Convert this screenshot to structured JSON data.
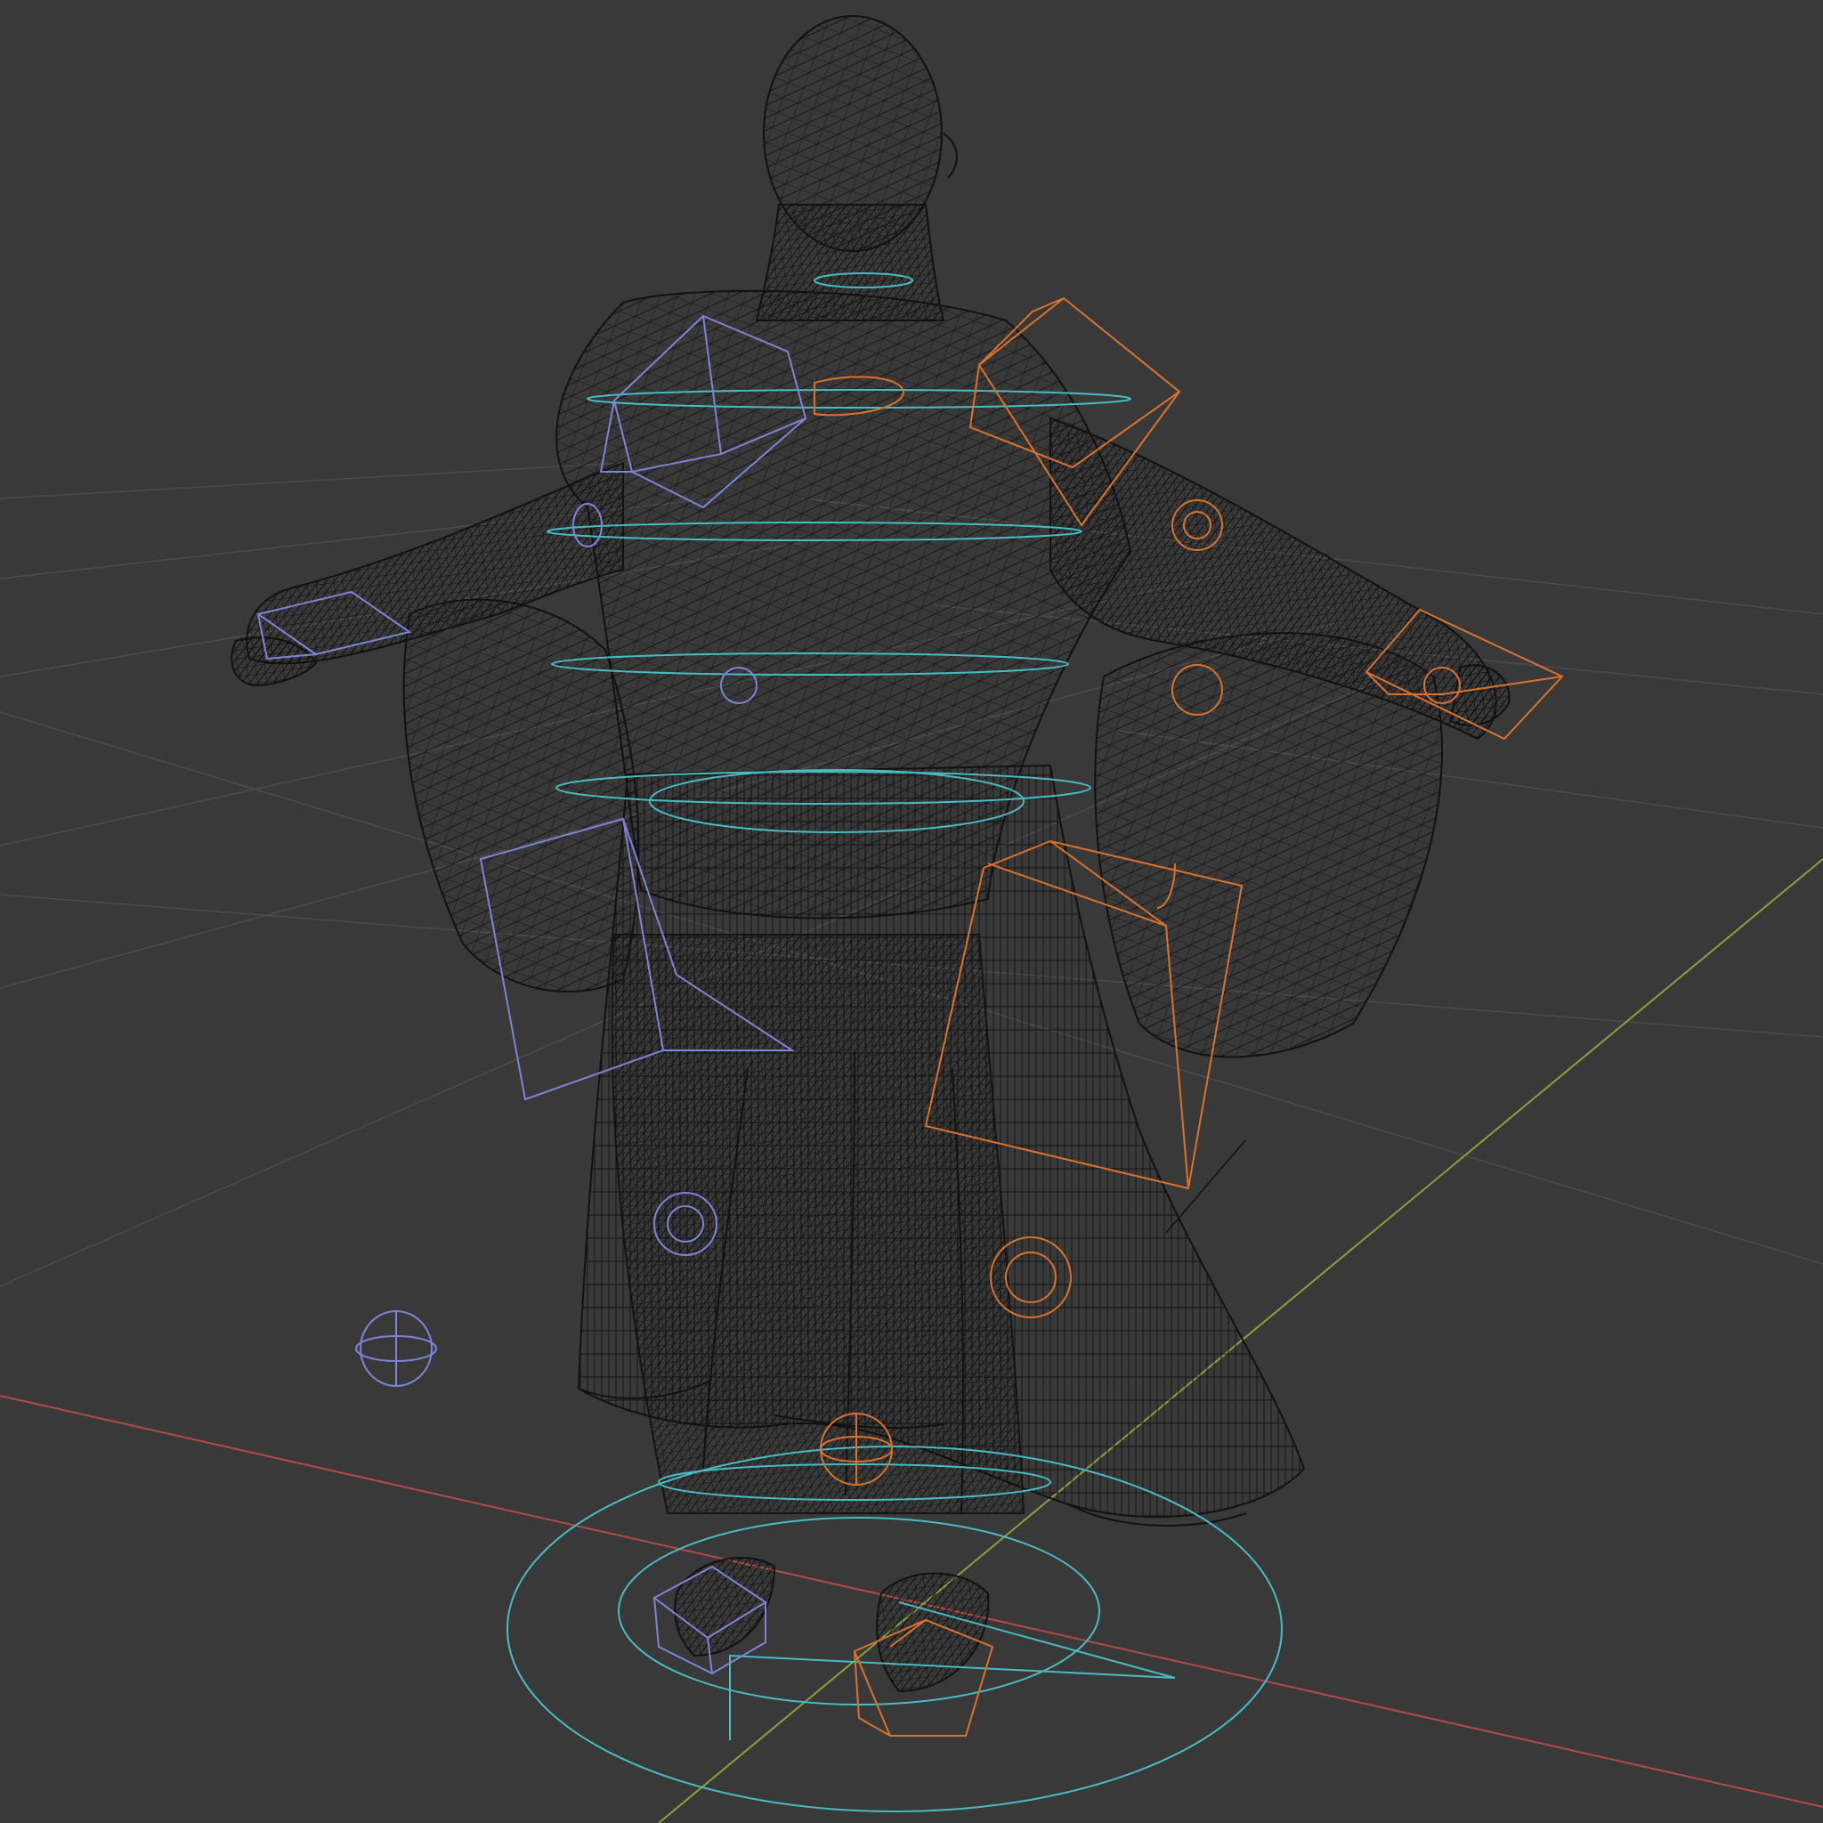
{
  "viewport": {
    "background": "#393939",
    "shading": "wireframe"
  },
  "colors": {
    "grid": "#4d4d4d",
    "x_axis": "#b34a4a",
    "y_axis": "#8aa03a",
    "mesh": "#121212",
    "rig_control_center": "#48bcc2",
    "rig_control_left": "#7d84d6",
    "rig_control_right": "#d9722d"
  },
  "scene": {
    "object": "character-mesh",
    "armature": "character-rig",
    "controls": [
      "root-circle-control",
      "neck-control",
      "chest-control",
      "spine-control",
      "hips-control",
      "pelvis-control",
      "shoulder-left-control",
      "shoulder-right-control",
      "hand-left-control",
      "hand-right-control",
      "hip-left-control",
      "hip-right-control",
      "knee-left-control",
      "knee-right-control",
      "foot-left-control",
      "foot-right-control",
      "pole-target-left",
      "pole-target-right"
    ]
  }
}
